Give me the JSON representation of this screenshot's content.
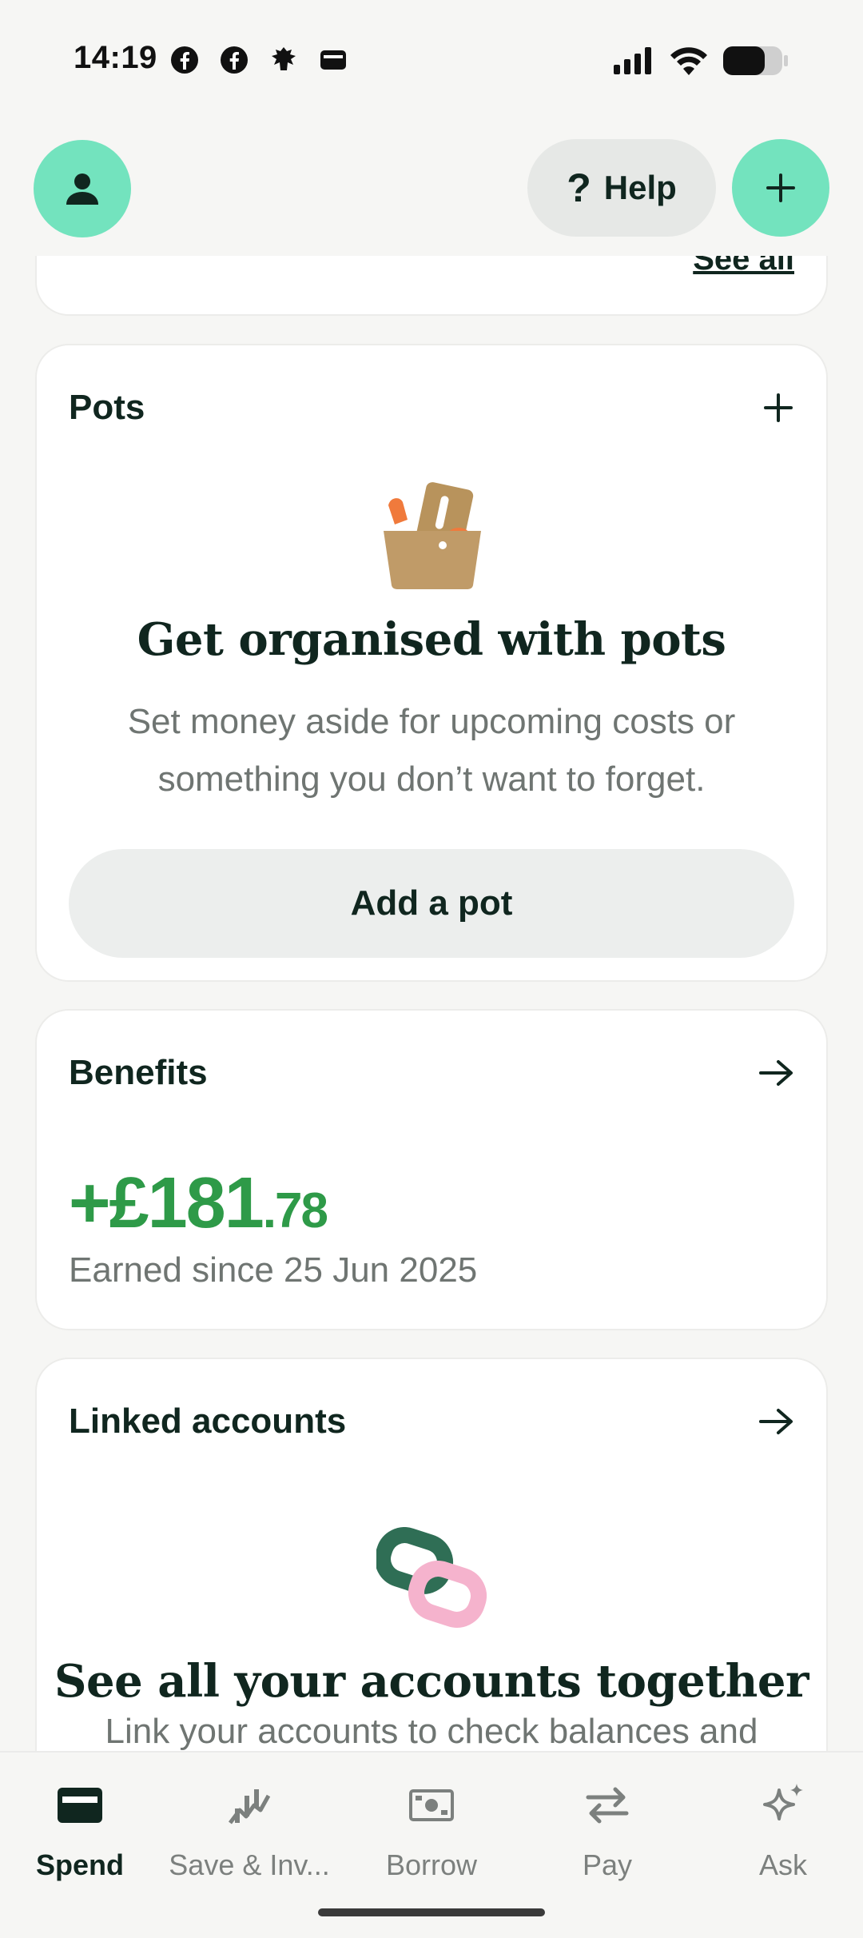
{
  "status_bar": {
    "time": "14:19",
    "left_icons": [
      "facebook-icon",
      "facebook-icon",
      "bank-eagle-icon",
      "wallet-icon"
    ],
    "right_icons": [
      "signal-icon",
      "wifi-icon",
      "battery-icon"
    ]
  },
  "header": {
    "help_label": "Help"
  },
  "previous_card": {
    "see_all": "See all"
  },
  "pots": {
    "title": "Pots",
    "empty_title": "Get organised with pots",
    "empty_text": "Set money aside for upcoming costs or something you don’t want to forget.",
    "button": "Add a pot"
  },
  "benefits": {
    "title": "Benefits",
    "amount_main": "+£181",
    "amount_decimal": ".78",
    "subtitle": "Earned since 25 Jun 2025"
  },
  "linked_accounts": {
    "title": "Linked accounts",
    "empty_title": "See all your accounts together",
    "empty_text": "Link your accounts to check balances and"
  },
  "bottom_nav": {
    "items": [
      {
        "label": "Spend",
        "icon": "card-icon",
        "active": true
      },
      {
        "label": "Save & Inv...",
        "icon": "growth-icon",
        "active": false
      },
      {
        "label": "Borrow",
        "icon": "cash-icon",
        "active": false
      },
      {
        "label": "Pay",
        "icon": "transfer-icon",
        "active": false
      },
      {
        "label": "Ask",
        "icon": "sparkle-icon",
        "active": false
      }
    ]
  },
  "colors": {
    "accent": "#73e3be",
    "positive": "#2e9a48",
    "text": "#10261f",
    "muted": "#6f7572"
  }
}
